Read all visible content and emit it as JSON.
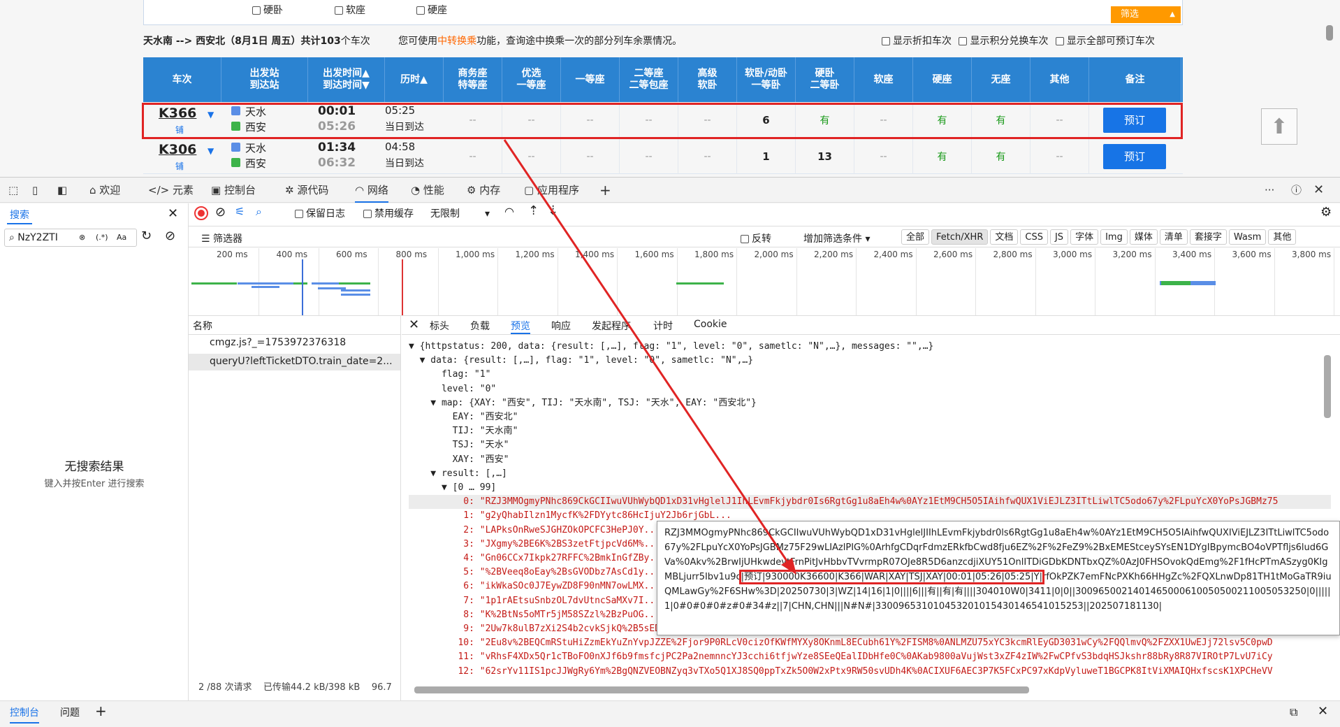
{
  "webpage": {
    "filters": {
      "hard_sleeper": "硬卧",
      "soft_seat": "软座",
      "hard_seat": "硬座",
      "filter_button": "筛选"
    },
    "summary_route": "天水南 --> 西安北（8月1日  周五）共计",
    "summary_count": "103",
    "summary_tail": "个车次",
    "summary_transfer_pre": "您可使用",
    "summary_transfer_link": "中转换乘",
    "summary_transfer_post": "功能，查询途中换乘一次的部分列车余票情况。",
    "options": [
      "显示折扣车次",
      "显示积分兑换车次",
      "显示全部可预订车次"
    ],
    "columns": [
      {
        "l1": "车次",
        "l2": ""
      },
      {
        "l1": "出发站",
        "l2": "到达站"
      },
      {
        "l1": "出发时间▲",
        "l2": "到达时间▼"
      },
      {
        "l1": "历时▲",
        "l2": ""
      },
      {
        "l1": "商务座",
        "l2": "特等座"
      },
      {
        "l1": "优选",
        "l2": "一等座"
      },
      {
        "l1": "一等座",
        "l2": ""
      },
      {
        "l1": "二等座",
        "l2": "二等包座"
      },
      {
        "l1": "高级",
        "l2": "软卧"
      },
      {
        "l1": "软卧/动卧",
        "l2": "一等卧"
      },
      {
        "l1": "硬卧",
        "l2": "二等卧"
      },
      {
        "l1": "软座",
        "l2": ""
      },
      {
        "l1": "硬座",
        "l2": ""
      },
      {
        "l1": "无座",
        "l2": ""
      },
      {
        "l1": "其他",
        "l2": ""
      },
      {
        "l1": "备注",
        "l2": ""
      }
    ],
    "trains": [
      {
        "no": "K366",
        "tag": "铺",
        "from": "天水",
        "to": "西安",
        "dep": "00:01",
        "arr": "05:26",
        "dur": "05:25",
        "arrive_day": "当日到达",
        "seats": [
          "--",
          "--",
          "--",
          "--",
          "--",
          "6",
          "有",
          "--",
          "有",
          "有",
          "--"
        ],
        "book": "预订"
      },
      {
        "no": "K306",
        "tag": "铺",
        "from": "天水",
        "to": "西安",
        "dep": "01:34",
        "arr": "06:32",
        "dur": "04:58",
        "arrive_day": "当日到达",
        "seats": [
          "--",
          "--",
          "--",
          "--",
          "--",
          "1",
          "13",
          "--",
          "有",
          "有",
          "--"
        ],
        "book": "预订"
      }
    ]
  },
  "devtools": {
    "tabs": [
      "欢迎",
      "元素",
      "控制台",
      "源代码",
      "网络",
      "性能",
      "内存",
      "应用程序"
    ],
    "search_tab": "搜索",
    "search_value": "NzY2ZTI",
    "regex": "(.*)",
    "case": "Aa",
    "no_results": "无搜索结果",
    "no_results_hint": "键入并按Enter 进行搜索",
    "net_toolbar": {
      "preserve_log": "保留日志",
      "disable_cache": "禁用缓存",
      "throttle": "无限制"
    },
    "filter_placeholder": "筛选器",
    "invert": "反转",
    "more_filters": "增加筛选条件",
    "type_filters": [
      "全部",
      "Fetch/XHR",
      "文档",
      "CSS",
      "JS",
      "字体",
      "Img",
      "媒体",
      "清单",
      "套接字",
      "Wasm",
      "其他"
    ],
    "ruler": [
      "200 ms",
      "400 ms",
      "600 ms",
      "800 ms",
      "1,000 ms",
      "1,200 ms",
      "1,400 ms",
      "1,600 ms",
      "1,800 ms",
      "2,000 ms",
      "2,200 ms",
      "2,400 ms",
      "2,600 ms",
      "2,800 ms",
      "3,000 ms",
      "3,200 ms",
      "3,400 ms",
      "3,600 ms",
      "3,800 ms"
    ],
    "name_header": "名称",
    "requests": [
      "cmgz.js?_=1753972376318",
      "queryU?leftTicketDTO.train_date=2..."
    ],
    "status": "2 /88 次请求    已传输44.2 kB/398 kB    96.7",
    "detail_tabs": [
      "标头",
      "负载",
      "预览",
      "响应",
      "发起程序",
      "计时",
      "Cookie"
    ],
    "preview_lines": [
      "▼ {httpstatus: 200, data: {result: [,…], flag: \"1\", level: \"0\", sametlc: \"N\",…}, messages: \"\",…}",
      "  ▼ data: {result: [,…], flag: \"1\", level: \"0\", sametlc: \"N\",…}",
      "      flag: \"1\"",
      "      level: \"0\"",
      "    ▼ map: {XAY: \"西安\", TIJ: \"天水南\", TSJ: \"天水\", EAY: \"西安北\"}",
      "        EAY: \"西安北\"",
      "        TIJ: \"天水南\"",
      "        TSJ: \"天水\"",
      "        XAY: \"西安\"",
      "    ▼ result: [,…]",
      "      ▼ [0 … 99]",
      "          0: \"RZJ3MMOgmyPNhc869CkGCIIwuVUhWybQD1xD31vHglelJ1IhLEvmFkjybdr0Is6RgtGg1u8aEh4w%0AYz1EtM9CH5O5IAihfwQUX1ViEJLZ3ITtLiwlTC5odo67y%2FLpuYcX0YoPsJGBMz75",
      "          1: \"g2yQhabIlzn1MycfK%2FDYytc86HcIjuY2Jb6rjGbL...",
      "          2: \"LAPksOnRweSJGHZOkOPCFC3HePJ0Y...",
      "          3: \"JXgmy%2BE6K%2BS3zetFtjpcVd6M%...",
      "          4: \"Gn06CCx7Ikpk27RFFC%2BmkInGfZBy...",
      "          5: \"%2BVeeq8oEay%2BsGVODbz7AsCd1y...",
      "          6: \"ikWkaSOc0J7EywZD8F90nMN7owLMX...",
      "          7: \"1p1rAEtsuSnbzOL7dvUtncSaMXv7I...",
      "          8: \"K%2BtNs5oMTr5jM58SZzl%2BzPuOG...",
      "          9: \"2Uw7k8ulB7zXi2S4b2cvkSjkQ%2B5sEDHk%2BB8JQwlXUMlWhm8KZ6ouXsuGxxirty7W1YLJOPES5UYc%0AeSCXiZdoF6JdE9kS53wkEVZW6boyLsAc%2BX%2BsRZZpgBUPxbM1izw9b2Zo8B",
      "         10: \"2Eu8v%2BEQCmRStuHiZzmEkYuZnYvpJZZE%2Fjor9P0RLcV0cizOfKWfMYXy8OKnmL8ECubh61Y%2FISM8%0ANLMZU75xYC3kcmRlEyGD3031wCy%2FQQlmvQ%2FZXX1UwEJj72lsv5C0pwD",
      "         11: \"vRhsF4XDx5Qr1cTBoFO0nXJf6b9fmsfcjPC2Pa2nemnncYJ3cchi6tfjwYze8SEeQEalIDbHfe0C%0AKab9800aVujWst3xZF4zIW%2FwCPfvS3bdqHSJkshr88bRy8R87VIROtP7LvU7iCy",
      "         12: \"62srYv11IS1pcJJWgRy6Ym%2BgQNZVEOBNZyq3vTXo5Q1XJ8SQ0ppTxZk5O0W2xPtx9RW50svUDh4K%0ACIXUF6AEC3P7K5FCxPC97xKdpVyluweT1BGCPK8ItViXMAIQHxfscsK1XPCHeVV"
    ],
    "tooltip_pre": "RZJ3MMOgmyPNhc869CkGCIIwuVUhWybQD1xD31vHglelJIIhLEvmFkjybdr0ls6RgtGg1u8aEh4w%0AYz1EtM9CH5O5IAihfwQUXIViEJLZ3ITtLiwlTC5odo67y%2FLpuYcX0YoPsJGBMz75F29wLIAzlPIG%0ArhfgCDqrFdmzERkfbCwd8fju6EZ%2F%2FeZ9%2BxEMEStceySYsEN1DYgIBpymcBO4oVPTfljs6lud6GVa%0Akv%2BrwIjUHkwdevtFrnPitJvHbbvTVvrmpR07OJe8R5D6anzcdjiXUY51OnlITDiGDbKDNTbxQZ%0AzJ0FHSOvokQdEmg%2F1fHcPTmASzyg0KIgMBLjurr5Ibv1u9c",
    "tooltip_highlight": "|预订|930000K36600|K366|WAR|XAY|TSJ|XAY|00:01|05:26|05:25|Y|",
    "tooltip_post": "rfOkPZK7emFNcPXKh66HHgZc%2FQXLnwDp81TH1tMoGaTR9iuQMLawGy%2F6SHw%3D|20250730|3|WZ|14|16|1|0||||6|||有||有|有||||304010W0|3411|0|0||3009650021401465000610050500211005053250|0|||||1|0#0#0#0#z#0#34#z||7|CHN,CHN|||N#N#|330096531010453201015430146541015253||202507181130|",
    "bottom_tabs": [
      "控制台",
      "问题"
    ]
  },
  "colors": {
    "header_blue": "#2b83d1",
    "book_blue": "#1774e6",
    "highlight_red": "#e02424",
    "available_green": "#1a9a1a",
    "filter_orange": "#ff9900"
  }
}
